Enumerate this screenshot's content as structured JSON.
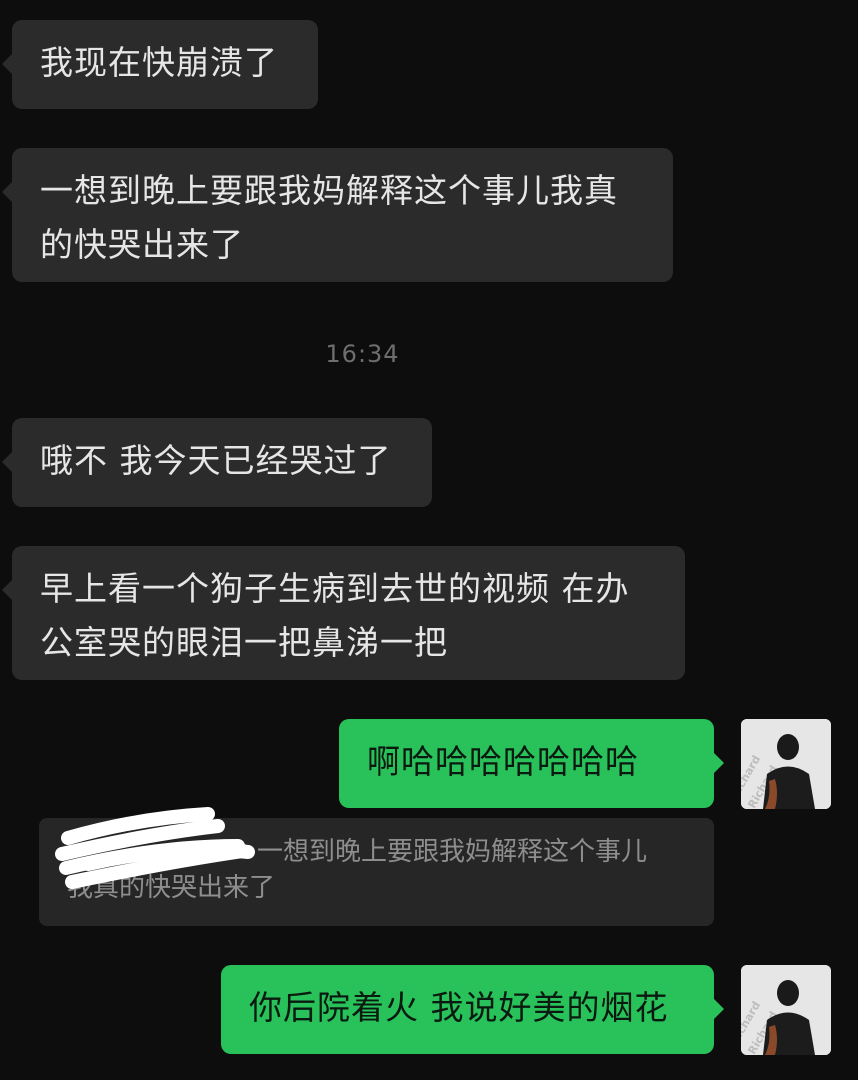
{
  "messages": {
    "m1": "我现在快崩溃了",
    "m2_line1": "一想到晚上要跟我妈解释这个事儿我真",
    "m2_line2": "的快哭出来了",
    "timestamp": "16:34",
    "m3": "哦不 我今天已经哭过了",
    "m4_line1": "早上看一个狗子生病到去世的视频 在办",
    "m4_line2": "公室哭的眼泪一把鼻涕一把",
    "m5": "啊哈哈哈哈哈哈哈",
    "quote_line1": "一想到晚上要跟我妈解释这个事儿",
    "quote_line2": "我真的快哭出来了",
    "m6": "你后院着火 我说好美的烟花"
  },
  "avatar": {
    "watermark_text": "Richard Richard Richard"
  },
  "colors": {
    "background": "#0d0d0d",
    "incoming_bubble": "#2b2b2b",
    "outgoing_bubble": "#28c15a",
    "timestamp": "#6e6e6e"
  }
}
